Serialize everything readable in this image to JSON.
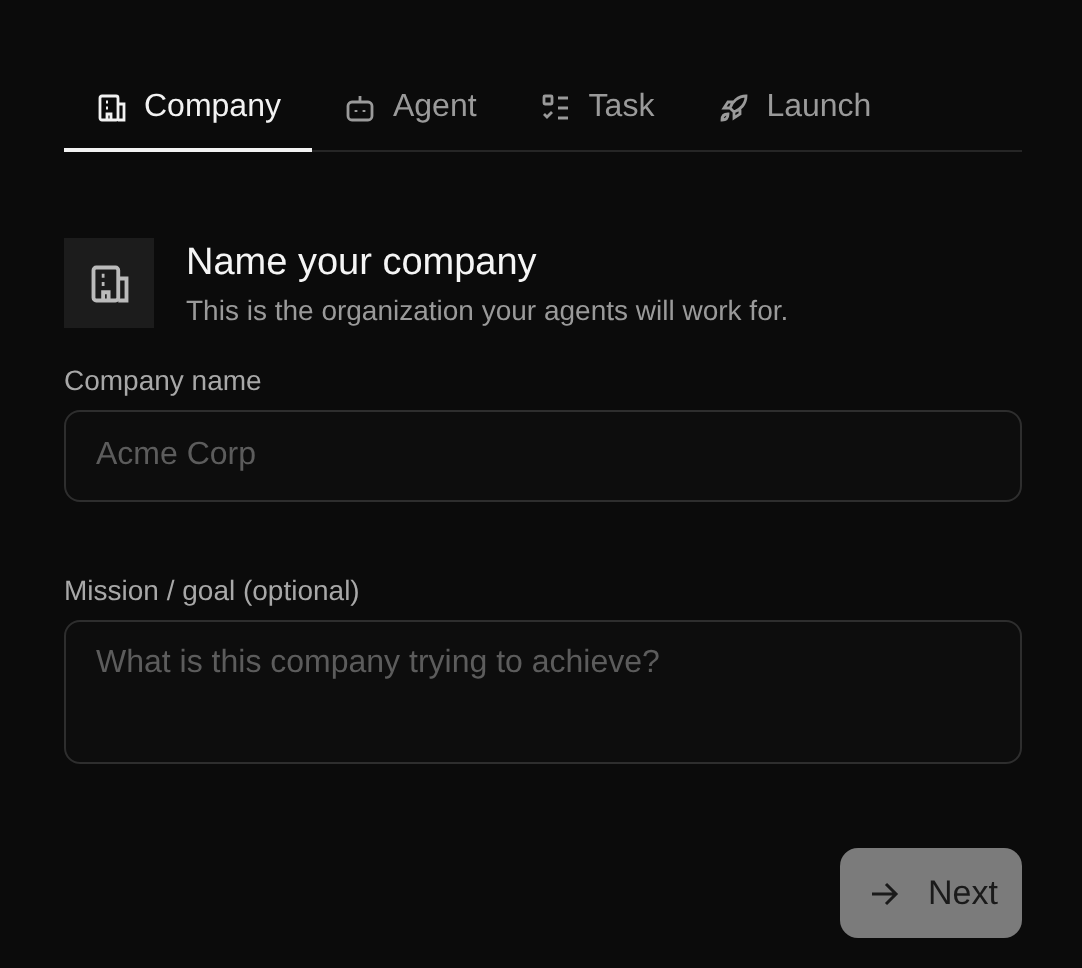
{
  "tabs": [
    {
      "label": "Company",
      "selected": true
    },
    {
      "label": "Agent",
      "selected": false
    },
    {
      "label": "Task",
      "selected": false
    },
    {
      "label": "Launch",
      "selected": false
    }
  ],
  "header": {
    "title": "Name your company",
    "subtitle": "This is the organization your agents will work for."
  },
  "fields": [
    {
      "label": "Company name",
      "placeholder": "Acme Corp",
      "kind": "input"
    },
    {
      "label": "Mission / goal (optional)",
      "placeholder": "What is this company trying to achieve?",
      "kind": "textarea"
    }
  ],
  "next_button": {
    "label": "Next",
    "disabled": true
  }
}
